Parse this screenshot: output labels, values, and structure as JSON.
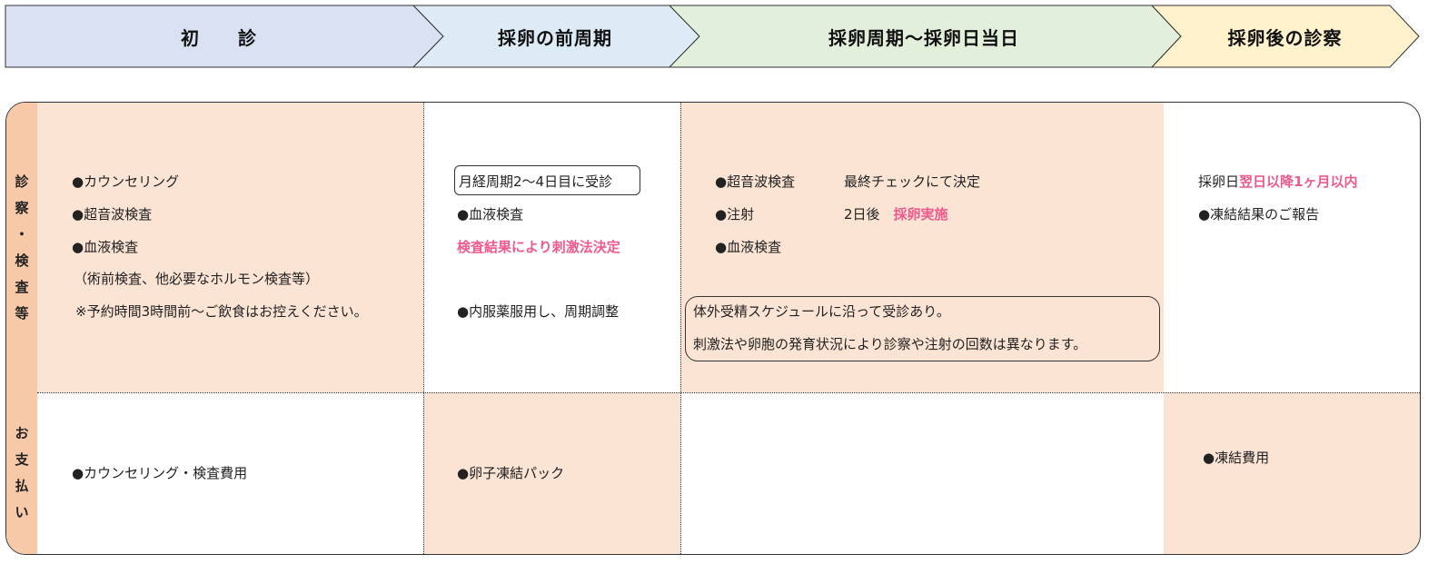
{
  "phases": [
    {
      "label": "初　　診",
      "color": "#d9e1f2"
    },
    {
      "label": "採卵の前周期",
      "color": "#ddebf7"
    },
    {
      "label": "採卵周期～採卵日当日",
      "color": "#e2efda"
    },
    {
      "label": "採卵後の診察",
      "color": "#fff2cc"
    }
  ],
  "rows": {
    "exam": [
      "診",
      "察",
      "・",
      "検",
      "査",
      "等"
    ],
    "payment": [
      "お",
      "支",
      "払",
      "い"
    ]
  },
  "exam": {
    "col1": {
      "items": [
        "●カウンセリング",
        "●超音波検査",
        "●血液検査"
      ],
      "note1": "（術前検査、他必要なホルモン検査等）",
      "note2": "※予約時間3時間前～ご飲食はお控えください。"
    },
    "col2": {
      "boxed": "月経周期2～4日目に受診",
      "item1": "●血液検査",
      "pink": "検査結果により刺激法決定",
      "item2": "●内服薬服用し、周期調整"
    },
    "col3": {
      "item1": "●超音波検査",
      "item1_side": "最終チェックにて決定",
      "item2": "●注射",
      "item2_side": "2日後　",
      "item2_pink": "採卵実施",
      "item3": "●血液検査",
      "note1": "体外受精スケジュールに沿って受診あり。",
      "note2": "刺激法や卵胞の発育状況により診察や注射の回数は異なります。"
    },
    "col4": {
      "prefix": "採卵日",
      "pink": "翌日以降1ヶ月以内",
      "item": "●凍結結果のご報告"
    }
  },
  "payment": {
    "col1": "●カウンセリング・検査費用",
    "col2": "●卵子凍結パック",
    "col4": "●凍結費用"
  },
  "colors": {
    "peach": "#fce4d5",
    "row_header": "#f8c9a8",
    "accent_pink": "#ee5a8e"
  }
}
